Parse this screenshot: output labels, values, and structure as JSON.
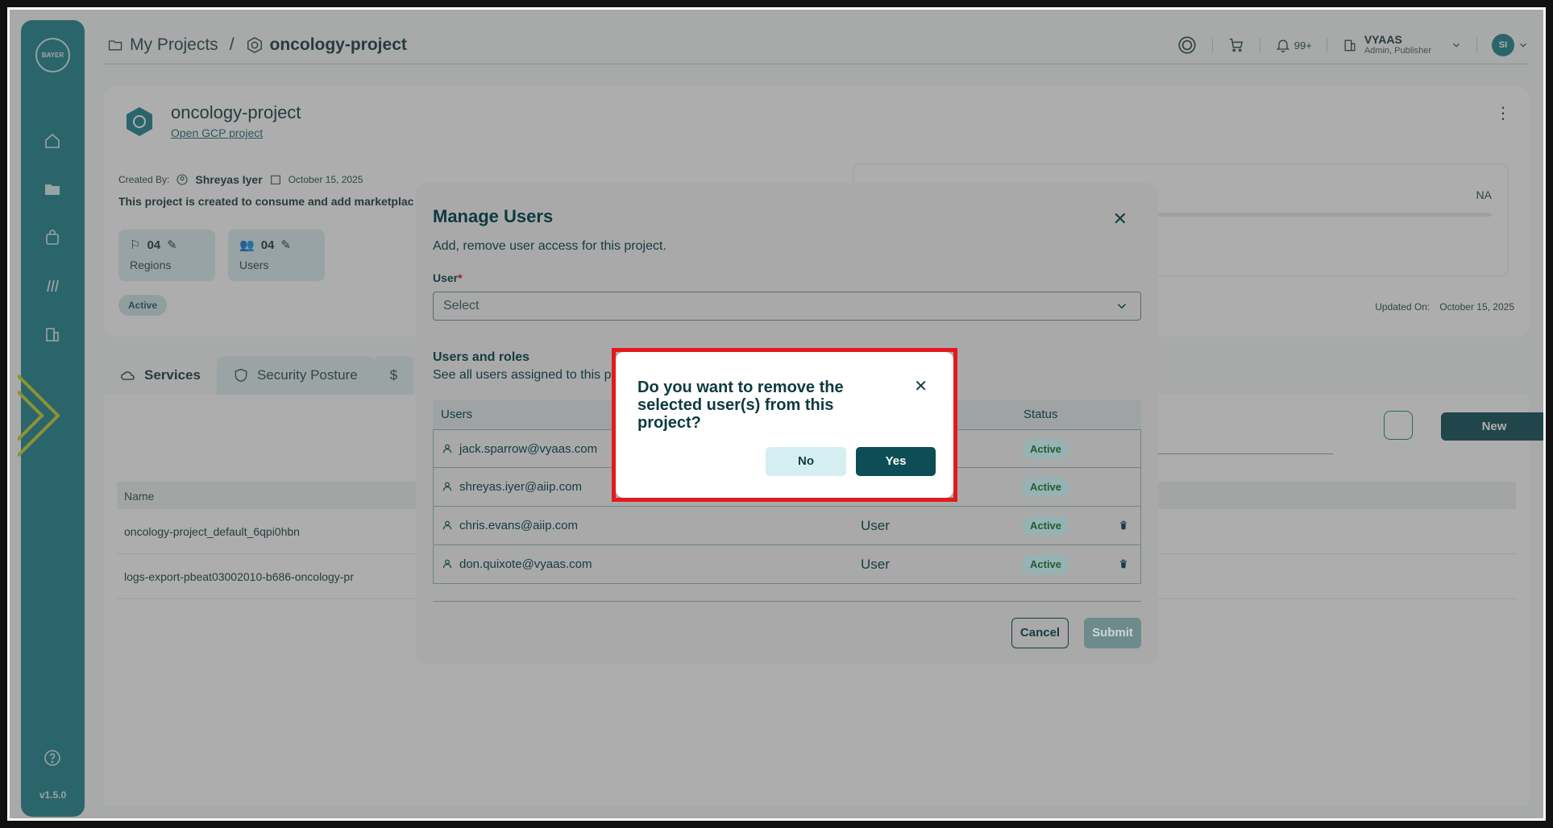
{
  "sidebar": {
    "logo_text": "BAYER",
    "version": "v1.5.0",
    "icons": [
      "home-icon",
      "folder-icon",
      "bag-icon",
      "docs-icon",
      "building-icon",
      "help-icon"
    ]
  },
  "header": {
    "breadcrumb_root": "My Projects",
    "breadcrumb_sep": "/",
    "breadcrumb_current": "oncology-project",
    "notifications": "99+",
    "org_name": "VYAAS",
    "org_role": "Admin, Publisher",
    "avatar_initials": "SI"
  },
  "project": {
    "title": "oncology-project",
    "gcp_link": "Open GCP project",
    "created_by_label": "Created By:",
    "created_by": "Shreyas Iyer",
    "created_date": "October 15, 2025",
    "description": "This project is created to consume and add marketplac",
    "regions_count": "04",
    "regions_label": "Regions",
    "users_count": "04",
    "users_label": "Users",
    "status": "Active",
    "na": "NA",
    "updated_label": "Updated On:",
    "updated_date": "October 15, 2025"
  },
  "tabs": [
    {
      "label": "Services"
    },
    {
      "label": "Security Posture"
    }
  ],
  "services_list": {
    "new_label": "New",
    "name_header": "Name",
    "rows": [
      "oncology-project_default_6qpi0hbn",
      "logs-export-pbeat03002010-b686-oncology-pr"
    ]
  },
  "manage_users": {
    "title": "Manage Users",
    "subtitle": "Add, remove user access for this project.",
    "user_label": "User",
    "required_mark": "*",
    "select_placeholder": "Select",
    "section_title": "Users and roles",
    "section_sub": "See all users assigned to this p",
    "headers": {
      "users": "Users",
      "status": "Status"
    },
    "rows": [
      {
        "email": "jack.sparrow@vyaas.com",
        "role": "",
        "status": "Active"
      },
      {
        "email": "shreyas.iyer@aiip.com",
        "role": "",
        "status": "Active"
      },
      {
        "email": "chris.evans@aiip.com",
        "role": "User",
        "status": "Active"
      },
      {
        "email": "don.quixote@vyaas.com",
        "role": "User",
        "status": "Active"
      }
    ],
    "cancel_label": "Cancel",
    "submit_label": "Submit"
  },
  "confirm": {
    "question": "Do you want to remove the selected user(s) from this project?",
    "no_label": "No",
    "yes_label": "Yes"
  },
  "colors": {
    "sidebar": "#1f8390",
    "primary": "#0d4d55",
    "highlight": "#e3191c"
  }
}
